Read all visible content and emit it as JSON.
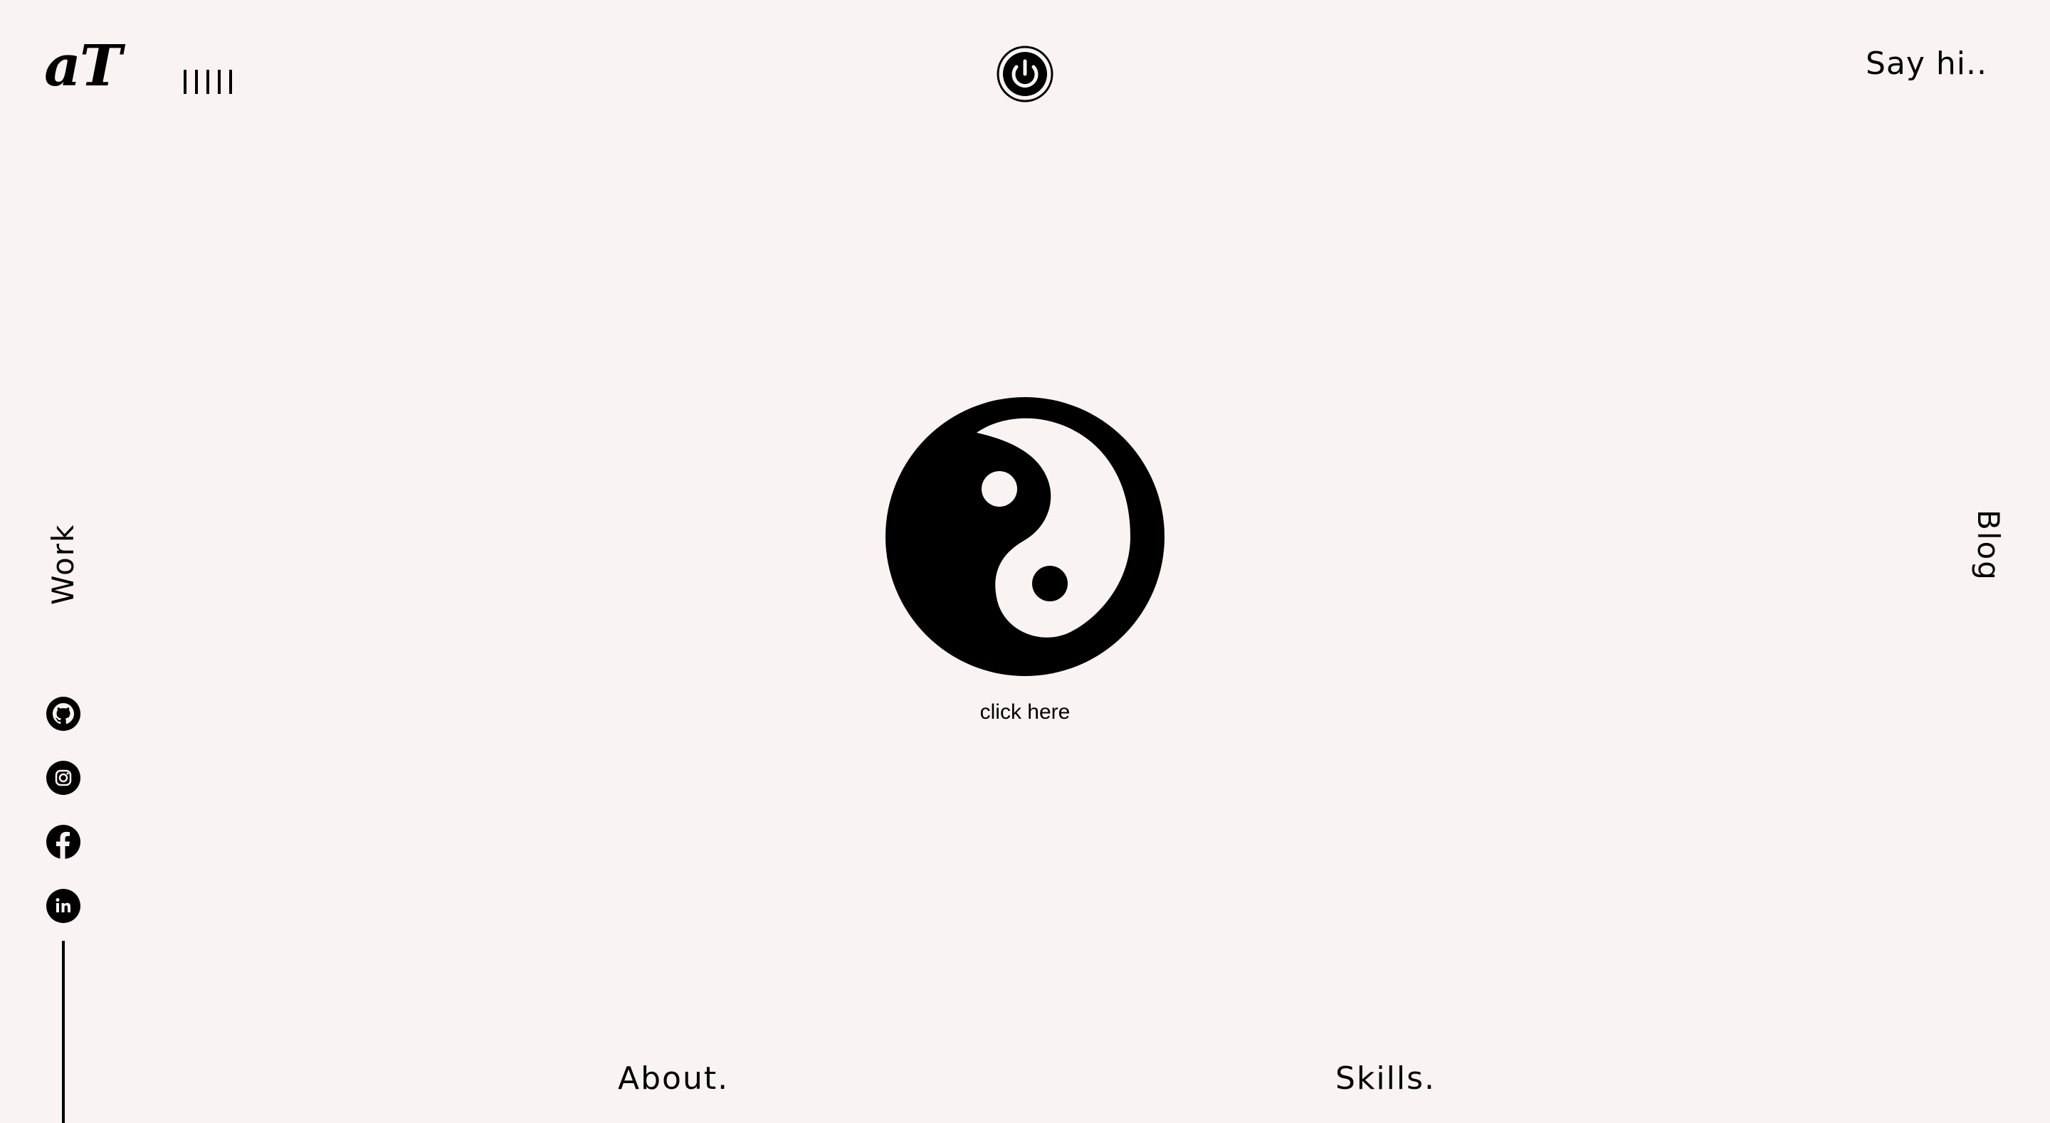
{
  "header": {
    "logo": "aT",
    "say_hi": "Say hi.."
  },
  "nav": {
    "work": "Work",
    "blog": "Blog",
    "about": "About.",
    "skills": "Skills."
  },
  "center": {
    "caption": "click here"
  },
  "social": [
    {
      "name": "github-icon"
    },
    {
      "name": "instagram-icon"
    },
    {
      "name": "facebook-icon"
    },
    {
      "name": "linkedin-icon"
    }
  ],
  "colors": {
    "background": "#f9f4f3",
    "foreground": "#000000"
  }
}
